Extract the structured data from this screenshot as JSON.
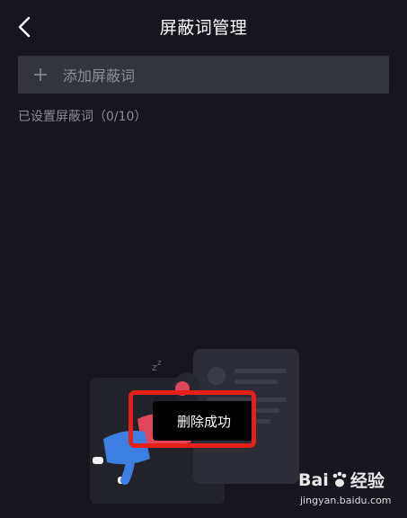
{
  "header": {
    "title": "屏蔽词管理",
    "back_icon": "chevron-left-icon"
  },
  "add_bar": {
    "icon": "plus-icon",
    "placeholder": "添加屏蔽词"
  },
  "status": {
    "count_text": "已设置屏蔽词（0/10）"
  },
  "toast": {
    "message": "删除成功"
  },
  "watermark": {
    "logo_part1": "Bai",
    "logo_part2": "经验",
    "url": "jingyan.baidu.com"
  },
  "colors": {
    "background": "#17161f",
    "input_bg": "#34343c",
    "highlight": "#e52019",
    "illustration_blue": "#3d7fe0",
    "illustration_pink": "#e0465a"
  }
}
